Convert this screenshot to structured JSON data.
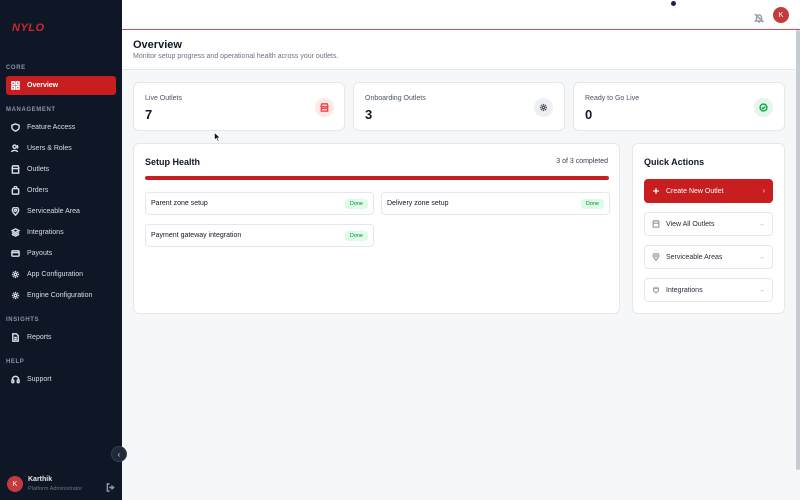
{
  "brand": {
    "logo": "NYLO"
  },
  "sidebar": {
    "sections": [
      {
        "label": "CORE"
      },
      {
        "label": "MANAGEMENT"
      },
      {
        "label": "INSIGHTS"
      },
      {
        "label": "HELP"
      }
    ],
    "items": [
      {
        "label": "Overview",
        "icon": "grid-icon"
      },
      {
        "label": "Feature Access",
        "icon": "shield-icon"
      },
      {
        "label": "Users & Roles",
        "icon": "users-icon"
      },
      {
        "label": "Outlets",
        "icon": "store-icon"
      },
      {
        "label": "Orders",
        "icon": "bag-icon"
      },
      {
        "label": "Serviceable Area",
        "icon": "map-pin-icon"
      },
      {
        "label": "Integrations",
        "icon": "layers-icon"
      },
      {
        "label": "Payouts",
        "icon": "card-icon"
      },
      {
        "label": "App Configuration",
        "icon": "gear-icon"
      },
      {
        "label": "Engine Configuration",
        "icon": "gear-icon"
      },
      {
        "label": "Reports",
        "icon": "file-icon"
      },
      {
        "label": "Support",
        "icon": "headset-icon"
      }
    ],
    "user": {
      "initial": "K",
      "name": "Karthik",
      "role": "Platform Administrator"
    }
  },
  "topbar": {
    "avatar_initial": "K"
  },
  "header": {
    "title": "Overview",
    "subtitle": "Monitor setup progress and operational health across your outlets."
  },
  "stats": [
    {
      "label": "Live Outlets",
      "value": "7",
      "icon": "store-icon",
      "color": "#e24b4f",
      "bg": "#fde8e8"
    },
    {
      "label": "Onboarding Outlets",
      "value": "3",
      "icon": "gear-icon",
      "color": "#4b5563",
      "bg": "#eeeff1"
    },
    {
      "label": "Ready to Go Live",
      "value": "0",
      "icon": "check-circle-icon",
      "color": "#16a34a",
      "bg": "#e3f6ea"
    }
  ],
  "setup_health": {
    "title": "Setup Health",
    "completed_text": "3 of 3 completed",
    "progress": 1.0,
    "items": [
      {
        "label": "Parent zone setup",
        "status": "Done"
      },
      {
        "label": "Delivery zone setup",
        "status": "Done"
      },
      {
        "label": "Payment gateway integration",
        "status": "Done"
      }
    ]
  },
  "quick_actions": {
    "title": "Quick Actions",
    "items": [
      {
        "label": "Create New Outlet",
        "icon": "plus-icon",
        "primary": true
      },
      {
        "label": "View All Outlets",
        "icon": "store-icon"
      },
      {
        "label": "Serviceable Areas",
        "icon": "map-pin-icon"
      },
      {
        "label": "Integrations",
        "icon": "plug-icon"
      }
    ]
  },
  "colors": {
    "accent": "#c81e20",
    "sidebar_bg": "#0f1726",
    "success": "#16a34a"
  }
}
